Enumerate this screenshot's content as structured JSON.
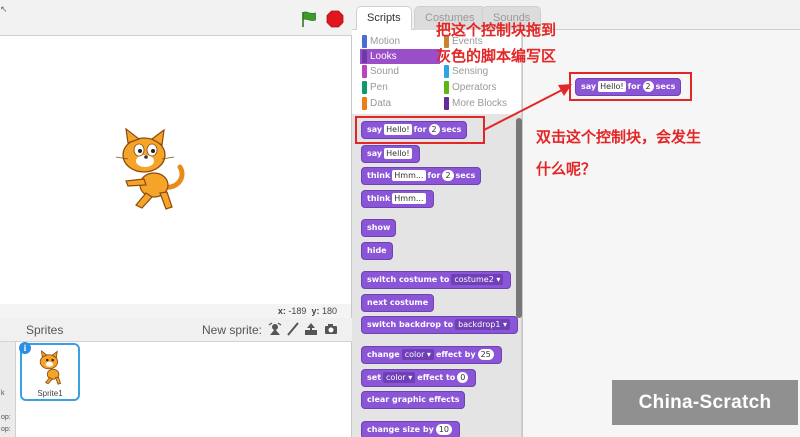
{
  "tabs": [
    "Scripts",
    "Costumes",
    "Sounds"
  ],
  "categories": [
    {
      "label": "Motion",
      "color": "#4a6cd4"
    },
    {
      "label": "Events",
      "color": "#c88330"
    },
    {
      "label": "Looks",
      "color": "#8a55d7",
      "selected": true
    },
    {
      "label": "Sensing",
      "color": "#2ca5e2"
    },
    {
      "label": "Sound",
      "color": "#bb42c3"
    },
    {
      "label": "Operators",
      "color": "#5cb712"
    },
    {
      "label": "Pen",
      "color": "#0e9a6c"
    },
    {
      "label": "More Blocks",
      "color": "#632d99"
    },
    {
      "label": "Data",
      "color": "#ee7d16"
    }
  ],
  "blocks": {
    "say_for": {
      "word": "say",
      "arg": "Hello!",
      "mid": "for",
      "num": "2",
      "end": "secs"
    },
    "say": {
      "word": "say",
      "arg": "Hello!"
    },
    "think_for": {
      "word": "think",
      "arg": "Hmm...",
      "mid": "for",
      "num": "2",
      "end": "secs"
    },
    "think": {
      "word": "think",
      "arg": "Hmm..."
    },
    "show": "show",
    "hide": "hide",
    "switch_costume": {
      "word": "switch costume to",
      "arg": "costume2"
    },
    "next_costume": "next costume",
    "switch_backdrop": {
      "word": "switch backdrop to",
      "arg": "backdrop1"
    },
    "change_effect": {
      "word": "change",
      "arg": "color",
      "mid": "effect by",
      "num": "25"
    },
    "set_effect": {
      "word": "set",
      "arg": "color",
      "mid": "effect to",
      "num": "0"
    },
    "clear_effects": "clear graphic effects",
    "change_size": {
      "word": "change size by",
      "num": "10"
    }
  },
  "script_block": {
    "word": "say",
    "arg": "Hello!",
    "mid": "for",
    "num": "2",
    "end": "secs"
  },
  "annotations": {
    "line1": "把这个控制块拖到",
    "line2": "灰色的脚本编写区",
    "line3": "双击这个控制块，会发生",
    "line4": "什么呢？"
  },
  "stage": {
    "x_label": "x:",
    "x": "-189",
    "y_label": "y:",
    "y": "180"
  },
  "sprites": {
    "title": "Sprites",
    "new_sprite": "New sprite:",
    "sprite_name": "Sprite1",
    "info": "i",
    "stage_col": [
      "k",
      "op:",
      "op:"
    ]
  },
  "watermark": "China-Scratch",
  "colors": {
    "looks": "#8a55d7",
    "annotation": "#e32626",
    "selected_border": "#39a0e3"
  }
}
